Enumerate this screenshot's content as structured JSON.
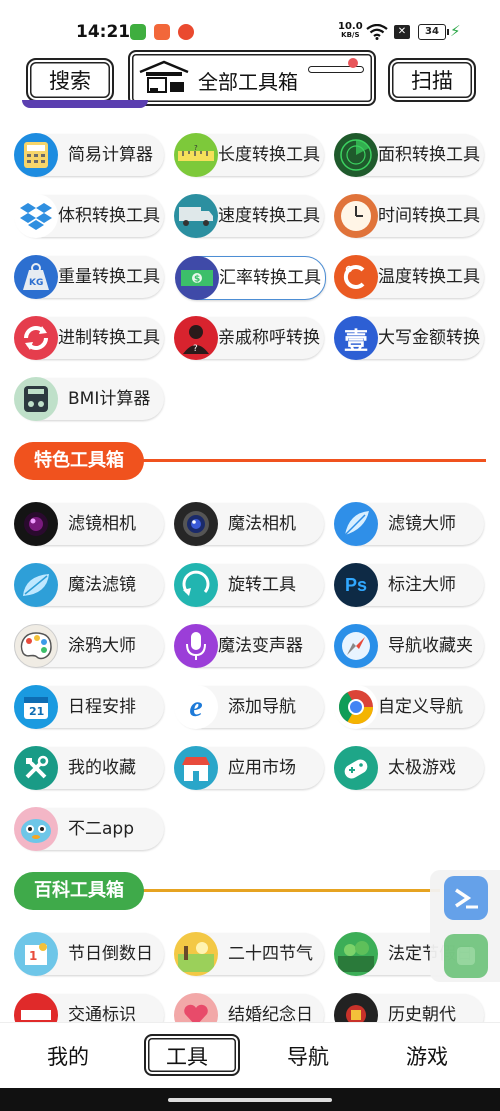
{
  "status": {
    "time": "14:21",
    "net_speed": "10.0",
    "net_unit": "KB/S",
    "battery": "34"
  },
  "header": {
    "search_label": "搜索",
    "title": "全部工具箱",
    "scan_label": "扫描"
  },
  "tools_basic": [
    {
      "label": "简易计算器",
      "icon": "calculator-icon",
      "color": "#1d8ce0"
    },
    {
      "label": "长度转换工具",
      "icon": "ruler-icon",
      "color": "#7dc93a"
    },
    {
      "label": "面积转换工具",
      "icon": "radar-icon",
      "color": "#1f5a2c"
    },
    {
      "label": "体积转换工具",
      "icon": "dropbox-icon",
      "color": "#2f8fe0"
    },
    {
      "label": "速度转换工具",
      "icon": "truck-icon",
      "color": "#2b8fa0"
    },
    {
      "label": "时间转换工具",
      "icon": "clock-icon",
      "color": "#e0733a"
    },
    {
      "label": "重量转换工具",
      "icon": "weight-icon",
      "color": "#2c6fd0"
    },
    {
      "label": "汇率转换工具",
      "icon": "money-icon",
      "color": "#3f4aa8"
    },
    {
      "label": "温度转换工具",
      "icon": "temperature-icon",
      "color": "#ea5a22"
    },
    {
      "label": "进制转换工具",
      "icon": "refresh-icon",
      "color": "#e53d4d"
    },
    {
      "label": "亲戚称呼转换",
      "icon": "person-icon",
      "color": "#d8232e"
    },
    {
      "label": "大写金额转换",
      "icon": "yuan-char-icon",
      "color": "#2d5fd4"
    },
    {
      "label": "BMI计算器",
      "icon": "scale-icon",
      "color": "#bfe0c9"
    }
  ],
  "sections": {
    "featured": "特色工具箱",
    "encyclopedia": "百科工具箱"
  },
  "tools_featured": [
    {
      "label": "滤镜相机",
      "icon": "camera-lens-icon",
      "color": "#141414"
    },
    {
      "label": "魔法相机",
      "icon": "camera-icon",
      "color": "#262626"
    },
    {
      "label": "滤镜大师",
      "icon": "feather-icon",
      "color": "#2f8fe8"
    },
    {
      "label": "魔法滤镜",
      "icon": "leaf-icon",
      "color": "#2e9fd8"
    },
    {
      "label": "旋转工具",
      "icon": "rotate-icon",
      "color": "#22b5b0"
    },
    {
      "label": "标注大师",
      "icon": "photoshop-icon",
      "color": "#0e2a45"
    },
    {
      "label": "涂鸦大师",
      "icon": "palette-icon",
      "color": "#f0ece4"
    },
    {
      "label": "魔法变声器",
      "icon": "microphone-icon",
      "color": "#9b3ed8"
    },
    {
      "label": "导航收藏夹",
      "icon": "compass-icon",
      "color": "#2a8fe8"
    },
    {
      "label": "日程安排",
      "icon": "calendar-icon",
      "color": "#1a9ae0"
    },
    {
      "label": "添加导航",
      "icon": "browser-e-icon",
      "color": "#ffffff"
    },
    {
      "label": "自定义导航",
      "icon": "chrome-icon",
      "color": "#ffffff"
    },
    {
      "label": "我的收藏",
      "icon": "tools-icon",
      "color": "#199b86"
    },
    {
      "label": "应用市场",
      "icon": "store-icon",
      "color": "#2aa6c9"
    },
    {
      "label": "太极游戏",
      "icon": "gamepad-icon",
      "color": "#1ea688"
    },
    {
      "label": "不二app",
      "icon": "mascot-icon",
      "color": "#f3b6c6"
    }
  ],
  "tools_encyclopedia": [
    {
      "label": "节日倒数日",
      "icon": "festival-icon",
      "color": "#6ec6e8"
    },
    {
      "label": "二十四节气",
      "icon": "solar-term-icon",
      "color": "#f3c845"
    },
    {
      "label": "法定节假日",
      "icon": "holiday-icon",
      "color": "#3cae57"
    },
    {
      "label": "交通标识",
      "icon": "traffic-sign-icon",
      "color": "#e02a2a"
    },
    {
      "label": "结婚纪念日",
      "icon": "wedding-icon",
      "color": "#f2a8a8"
    },
    {
      "label": "历史朝代",
      "icon": "history-icon",
      "color": "#222222"
    }
  ],
  "bottom_nav": [
    {
      "label": "我的"
    },
    {
      "label": "工具"
    },
    {
      "label": "导航"
    },
    {
      "label": "游戏"
    }
  ],
  "colors": {
    "featured_accent": "#f0521e",
    "encyclopedia_accent": "#3faa4a",
    "encyclopedia_line": "#e6a321",
    "selected_border": "#4d8ed4"
  }
}
